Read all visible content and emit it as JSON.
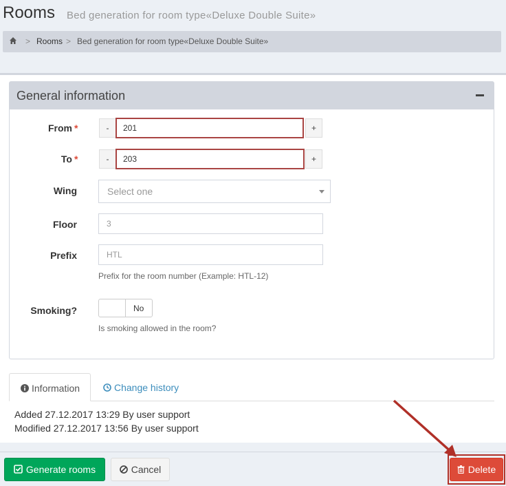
{
  "header": {
    "title": "Rooms",
    "subtitle": "Bed generation for room type«Deluxe Double Suite»"
  },
  "breadcrumb": {
    "separator": ">",
    "link": "Rooms",
    "current": "Bed generation for room type«Deluxe Double Suite»"
  },
  "panel": {
    "title": "General information"
  },
  "form": {
    "required_mark": "*",
    "from": {
      "label": "From",
      "value": "201",
      "minus": "-",
      "plus": "+"
    },
    "to": {
      "label": "To",
      "value": "203",
      "minus": "-",
      "plus": "+"
    },
    "wing": {
      "label": "Wing",
      "placeholder": "Select one"
    },
    "floor": {
      "label": "Floor",
      "placeholder": "3"
    },
    "prefix": {
      "label": "Prefix",
      "placeholder": "HTL",
      "help": "Prefix for the room number (Example: HTL-12)"
    },
    "smoking": {
      "label": "Smoking?",
      "toggle_label": "No",
      "help": "Is smoking allowed in the room?"
    }
  },
  "tabs": [
    {
      "label": "Information",
      "icon": "info-circle-icon",
      "active": true
    },
    {
      "label": "Change history",
      "icon": "clock-icon",
      "active": false
    }
  ],
  "info": {
    "added": "Added 27.12.2017 13:29 By user support",
    "modified": "Modified 27.12.2017 13:56 By user support"
  },
  "actions": {
    "generate": "Generate rooms",
    "cancel": "Cancel",
    "delete": "Delete"
  },
  "colors": {
    "success": "#00a65a",
    "danger": "#dd4b39",
    "link": "#3c8dbc",
    "annotation": "#b03028"
  }
}
